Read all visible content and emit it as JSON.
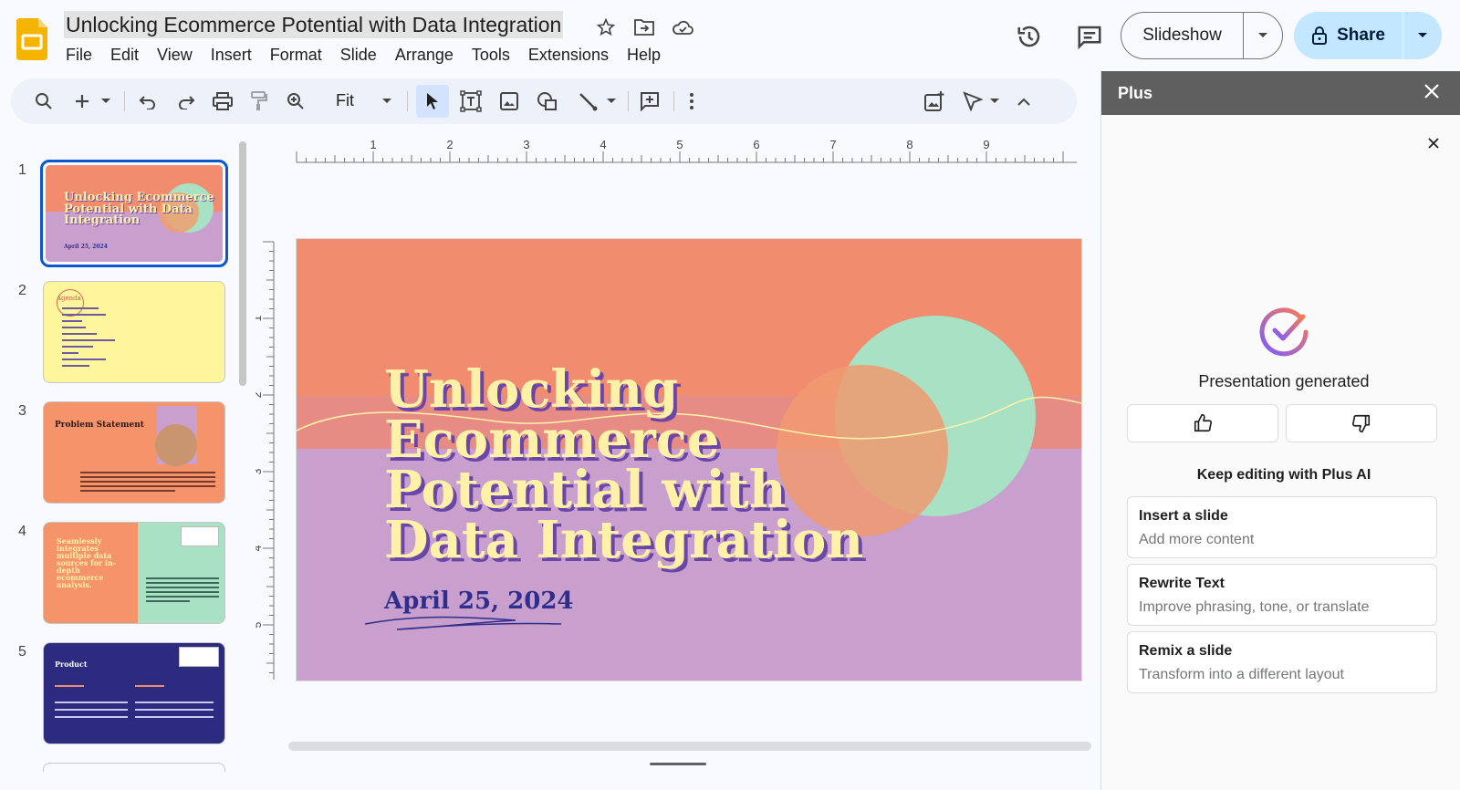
{
  "document": {
    "title": "Unlocking Ecommerce Potential with Data Integration"
  },
  "menu": [
    "File",
    "Edit",
    "View",
    "Insert",
    "Format",
    "Slide",
    "Arrange",
    "Tools",
    "Extensions",
    "Help"
  ],
  "header": {
    "slideshow_label": "Slideshow",
    "share_label": "Share"
  },
  "toolbar": {
    "zoom_value": "Fit"
  },
  "ruler": {
    "h_ticks": [
      "1",
      "2",
      "3",
      "4",
      "5",
      "6",
      "7",
      "8",
      "9"
    ],
    "v_ticks": [
      "1",
      "2",
      "3",
      "4",
      "5"
    ]
  },
  "slides": [
    {
      "number": "1",
      "title": "Unlocking Ecommerce Potential with Data Integration",
      "date": "April 25, 2024"
    },
    {
      "number": "2",
      "title": "Agenda"
    },
    {
      "number": "3",
      "title": "Problem Statement"
    },
    {
      "number": "4",
      "title": "Seamlessly integrates multiple data sources for in-depth ecommerce analysis."
    },
    {
      "number": "5",
      "title": "Product"
    }
  ],
  "main_slide": {
    "title_lines": [
      "Unlocking",
      "Ecommerce",
      "Potential with",
      "Data Integration"
    ],
    "date": "April 25, 2024"
  },
  "panel": {
    "title": "Plus",
    "status": "Presentation generated",
    "keep_editing": "Keep editing with Plus AI",
    "actions": [
      {
        "title": "Insert a slide",
        "subtitle": "Add more content"
      },
      {
        "title": "Rewrite Text",
        "subtitle": "Improve phrasing, tone, or translate"
      },
      {
        "title": "Remix a slide",
        "subtitle": "Transform into a different layout"
      }
    ]
  },
  "colors": {
    "accent": "#0b57d0",
    "share_bg": "#c2e7ff",
    "slide_orange": "#f28c6e",
    "slide_purple": "#c9a0cd",
    "slide_mint": "#a8e1c4",
    "title_yellow": "#fff2a8"
  }
}
